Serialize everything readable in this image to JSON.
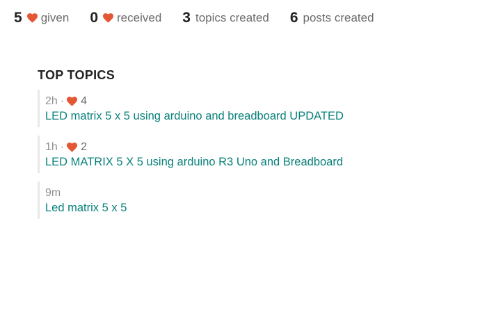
{
  "colors": {
    "heart": "#e45735",
    "link": "#08807a",
    "muted": "#919191"
  },
  "stats": [
    {
      "value": "5",
      "icon": "heart-icon",
      "label": "given"
    },
    {
      "value": "0",
      "icon": "heart-icon",
      "label": "received"
    },
    {
      "value": "3",
      "label": "topics created"
    },
    {
      "value": "6",
      "label": "posts created"
    }
  ],
  "top_topics": {
    "title": "TOP TOPICS",
    "items": [
      {
        "age": "2h",
        "separator": "·",
        "likes": "4",
        "title": "LED matrix 5 x 5 using arduino and breadboard UPDATED"
      },
      {
        "age": "1h",
        "separator": "·",
        "likes": "2",
        "title": "LED MATRIX 5 X 5 using arduino R3 Uno and Breadboard"
      },
      {
        "age": "9m",
        "title": "Led matrix 5 x 5"
      }
    ]
  }
}
